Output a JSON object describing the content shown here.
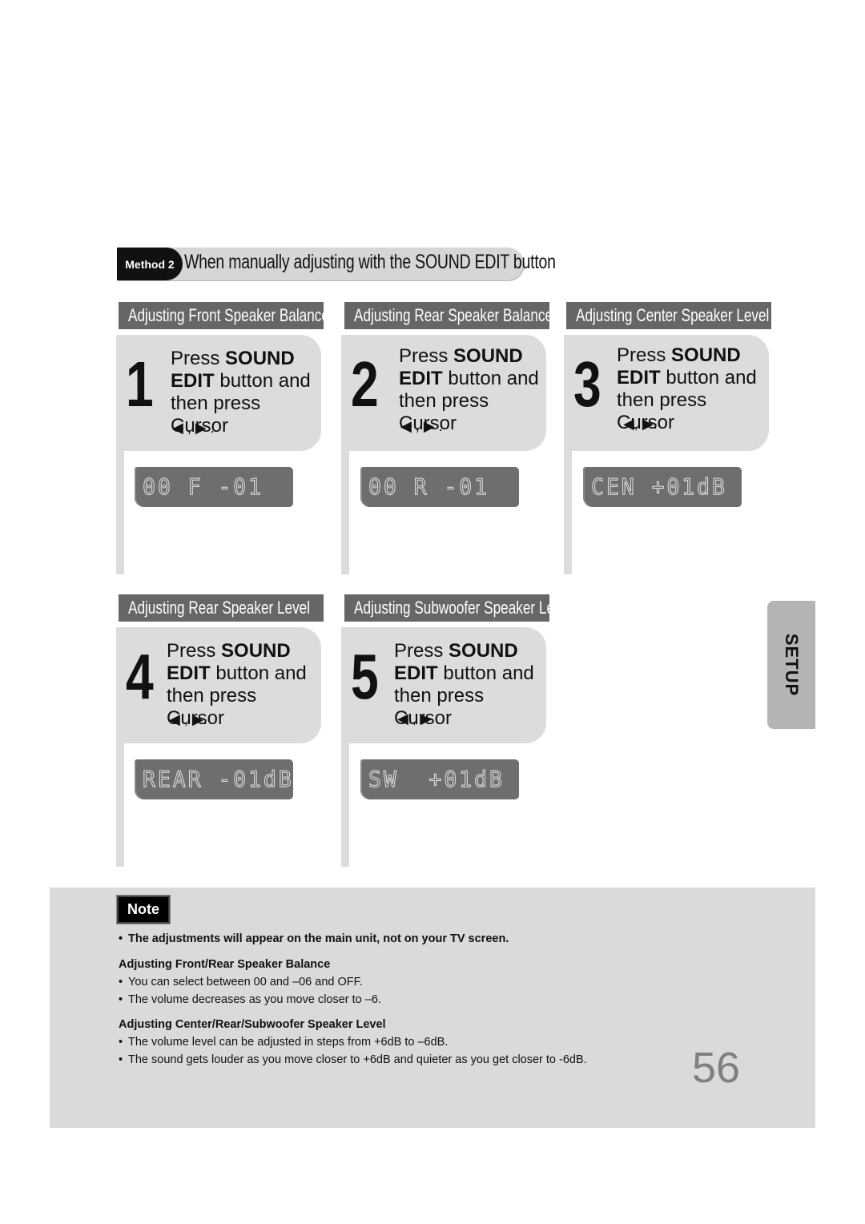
{
  "method_banner": {
    "badge": "Method 2",
    "title": "When manually adjusting with the SOUND EDIT button"
  },
  "sections": [
    {
      "header": "Adjusting Front Speaker Balance",
      "step_number": "1",
      "instr_pre": "Press ",
      "instr_bold1": "SOUND",
      "instr_bold2": "EDIT",
      "instr_mid": " button and",
      "instr_end": "then press Cursor",
      "cursor": "◀ , ▶ .",
      "lcd": "00 F -01"
    },
    {
      "header": "Adjusting Rear Speaker Balance",
      "step_number": "2",
      "instr_pre": "Press ",
      "instr_bold1": "SOUND",
      "instr_bold2": "EDIT",
      "instr_mid": " button and",
      "instr_end": "then press Cursor",
      "cursor": "◀ , ▶ .",
      "lcd": "00 R -01"
    },
    {
      "header": "Adjusting Center Speaker Level",
      "step_number": "3",
      "instr_pre": "Press ",
      "instr_bold1": "SOUND",
      "instr_bold2": "EDIT",
      "instr_mid": " button and",
      "instr_end": "then press Cursor",
      "cursor": "◀, ▶.",
      "lcd": "CEN +01dB"
    },
    {
      "header": "Adjusting Rear Speaker Level",
      "step_number": "4",
      "instr_pre": "Press ",
      "instr_bold1": "SOUND",
      "instr_bold2": "EDIT",
      "instr_mid": " button and",
      "instr_end": "then press Cursor",
      "cursor": "◀ , ▶.",
      "lcd": "REAR -01dB"
    },
    {
      "header": "Adjusting Subwoofer Speaker Level",
      "step_number": "5",
      "instr_pre": "Press ",
      "instr_bold1": "SOUND",
      "instr_bold2": "EDIT",
      "instr_mid": " button and",
      "instr_end": "then press Cursor",
      "cursor": "◀ , ▶ .",
      "lcd": "SW  +01dB"
    }
  ],
  "side_tab": {
    "label": "SETUP"
  },
  "note": {
    "badge": "Note",
    "main_bullet": "The adjustments will appear on the main unit, not on your TV screen.",
    "group1_title": "Adjusting Front/Rear Speaker Balance",
    "group1_items": [
      "You can select between 00 and –06 and OFF.",
      "The volume decreases as you move closer to –6."
    ],
    "group2_title": "Adjusting Center/Rear/Subwoofer Speaker Level",
    "group2_items": [
      "The volume level can be adjusted in steps from +6dB to –6dB.",
      "The sound gets louder as you move closer to +6dB and quieter as you get closer to -6dB."
    ],
    "bullet_glyph": "•"
  },
  "page_number": "56"
}
